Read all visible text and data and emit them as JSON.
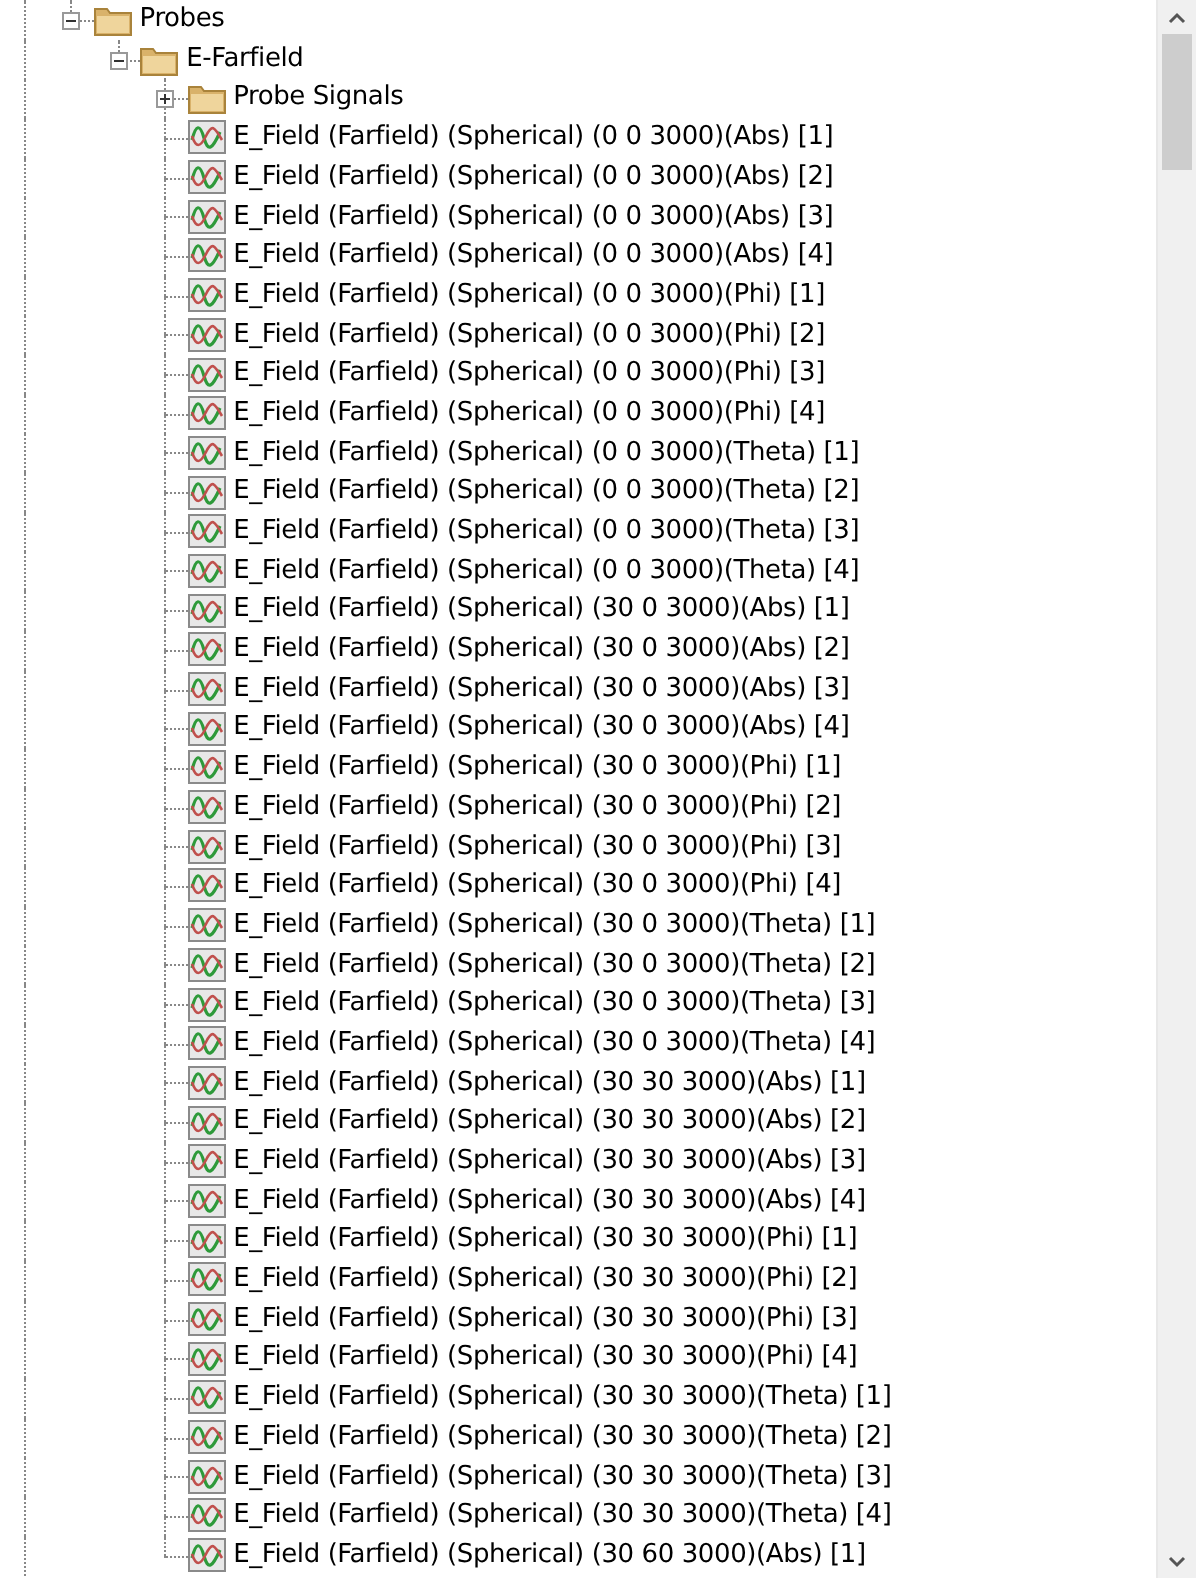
{
  "tree": [
    {
      "label": "Probes",
      "kind": "folder",
      "expanded": true,
      "children": [
        {
          "label": "E-Farfield",
          "kind": "folder",
          "expanded": true,
          "children": [
            {
              "label": "Probe Signals",
              "kind": "folder",
              "expanded": false
            },
            {
              "label": "E_Field (Farfield) (Spherical) (0 0 3000)(Abs) [1]",
              "kind": "signal"
            },
            {
              "label": "E_Field (Farfield) (Spherical) (0 0 3000)(Abs) [2]",
              "kind": "signal"
            },
            {
              "label": "E_Field (Farfield) (Spherical) (0 0 3000)(Abs) [3]",
              "kind": "signal"
            },
            {
              "label": "E_Field (Farfield) (Spherical) (0 0 3000)(Abs) [4]",
              "kind": "signal"
            },
            {
              "label": "E_Field (Farfield) (Spherical) (0 0 3000)(Phi) [1]",
              "kind": "signal"
            },
            {
              "label": "E_Field (Farfield) (Spherical) (0 0 3000)(Phi) [2]",
              "kind": "signal"
            },
            {
              "label": "E_Field (Farfield) (Spherical) (0 0 3000)(Phi) [3]",
              "kind": "signal"
            },
            {
              "label": "E_Field (Farfield) (Spherical) (0 0 3000)(Phi) [4]",
              "kind": "signal"
            },
            {
              "label": "E_Field (Farfield) (Spherical) (0 0 3000)(Theta) [1]",
              "kind": "signal"
            },
            {
              "label": "E_Field (Farfield) (Spherical) (0 0 3000)(Theta) [2]",
              "kind": "signal"
            },
            {
              "label": "E_Field (Farfield) (Spherical) (0 0 3000)(Theta) [3]",
              "kind": "signal"
            },
            {
              "label": "E_Field (Farfield) (Spherical) (0 0 3000)(Theta) [4]",
              "kind": "signal"
            },
            {
              "label": "E_Field (Farfield) (Spherical) (30 0 3000)(Abs) [1]",
              "kind": "signal"
            },
            {
              "label": "E_Field (Farfield) (Spherical) (30 0 3000)(Abs) [2]",
              "kind": "signal"
            },
            {
              "label": "E_Field (Farfield) (Spherical) (30 0 3000)(Abs) [3]",
              "kind": "signal"
            },
            {
              "label": "E_Field (Farfield) (Spherical) (30 0 3000)(Abs) [4]",
              "kind": "signal"
            },
            {
              "label": "E_Field (Farfield) (Spherical) (30 0 3000)(Phi) [1]",
              "kind": "signal"
            },
            {
              "label": "E_Field (Farfield) (Spherical) (30 0 3000)(Phi) [2]",
              "kind": "signal"
            },
            {
              "label": "E_Field (Farfield) (Spherical) (30 0 3000)(Phi) [3]",
              "kind": "signal"
            },
            {
              "label": "E_Field (Farfield) (Spherical) (30 0 3000)(Phi) [4]",
              "kind": "signal"
            },
            {
              "label": "E_Field (Farfield) (Spherical) (30 0 3000)(Theta) [1]",
              "kind": "signal"
            },
            {
              "label": "E_Field (Farfield) (Spherical) (30 0 3000)(Theta) [2]",
              "kind": "signal"
            },
            {
              "label": "E_Field (Farfield) (Spherical) (30 0 3000)(Theta) [3]",
              "kind": "signal"
            },
            {
              "label": "E_Field (Farfield) (Spherical) (30 0 3000)(Theta) [4]",
              "kind": "signal"
            },
            {
              "label": "E_Field (Farfield) (Spherical) (30 30 3000)(Abs) [1]",
              "kind": "signal"
            },
            {
              "label": "E_Field (Farfield) (Spherical) (30 30 3000)(Abs) [2]",
              "kind": "signal"
            },
            {
              "label": "E_Field (Farfield) (Spherical) (30 30 3000)(Abs) [3]",
              "kind": "signal"
            },
            {
              "label": "E_Field (Farfield) (Spherical) (30 30 3000)(Abs) [4]",
              "kind": "signal"
            },
            {
              "label": "E_Field (Farfield) (Spherical) (30 30 3000)(Phi) [1]",
              "kind": "signal"
            },
            {
              "label": "E_Field (Farfield) (Spherical) (30 30 3000)(Phi) [2]",
              "kind": "signal"
            },
            {
              "label": "E_Field (Farfield) (Spherical) (30 30 3000)(Phi) [3]",
              "kind": "signal"
            },
            {
              "label": "E_Field (Farfield) (Spherical) (30 30 3000)(Phi) [4]",
              "kind": "signal"
            },
            {
              "label": "E_Field (Farfield) (Spherical) (30 30 3000)(Theta) [1]",
              "kind": "signal"
            },
            {
              "label": "E_Field (Farfield) (Spherical) (30 30 3000)(Theta) [2]",
              "kind": "signal"
            },
            {
              "label": "E_Field (Farfield) (Spherical) (30 30 3000)(Theta) [3]",
              "kind": "signal"
            },
            {
              "label": "E_Field (Farfield) (Spherical) (30 30 3000)(Theta) [4]",
              "kind": "signal"
            },
            {
              "label": "E_Field (Farfield) (Spherical) (30 60 3000)(Abs) [1]",
              "kind": "signal"
            }
          ]
        }
      ]
    }
  ]
}
